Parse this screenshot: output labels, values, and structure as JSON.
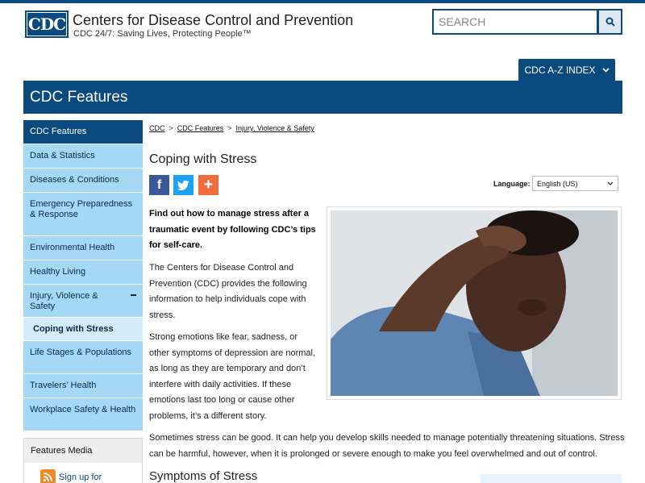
{
  "header": {
    "logo_text": "CDC",
    "agency_name": "Centers for Disease Control and Prevention",
    "tagline": "CDC 24/7: Saving Lives, Protecting People™",
    "search_placeholder": "SEARCH",
    "search_icon": "search-icon",
    "az_index_label": "CDC A-Z INDEX"
  },
  "banner": {
    "title": "CDC Features"
  },
  "sidebar": {
    "items": [
      {
        "label": "CDC Features",
        "active": true
      },
      {
        "label": "Data & Statistics"
      },
      {
        "label": "Diseases & Conditions"
      },
      {
        "label": "Emergency Preparedness & Response"
      },
      {
        "label": "Environmental Health"
      },
      {
        "label": "Healthy Living"
      },
      {
        "label": "Injury, Violence & Safety",
        "expanded": true
      },
      {
        "label": "Coping with Stress",
        "sub": true
      },
      {
        "label": "Life Stages & Populations"
      },
      {
        "label": "Travelers’ Health"
      },
      {
        "label": "Workplace Safety & Health"
      }
    ],
    "features_media": {
      "title": "Features Media",
      "signup_label": "Sign up for"
    }
  },
  "breadcrumb": {
    "items": [
      "CDC",
      "CDC Features",
      "Injury, Violence & Safety"
    ],
    "separator": ">"
  },
  "article": {
    "title": "Coping with Stress",
    "share": {
      "facebook": "f",
      "twitter": "twitter-icon",
      "plus": "+"
    },
    "language_label": "Language:",
    "language_value": "English (US)",
    "lead": "Find out how to manage stress after a traumatic event by following CDC’s tips for self-care.",
    "para1": "The Centers for Disease Control and Prevention (CDC) provides the following information to help individuals cope with stress.",
    "para2": "Strong emotions like fear, sadness, or other symptoms of depression are normal, as long as they are temporary and don’t interfere with daily activities. If these emotions last too long or cause other problems, it’s a different story.",
    "para3": "Sometimes stress can be good. It can help you develop skills needed to manage potentially threatening situations. Stress can be harmful, however, when it is prolonged or severe enough to make you feel overwhelmed and out of control.",
    "section_title": "Symptoms of Stress"
  },
  "colors": {
    "brand_blue": "#0b4a7e",
    "nav_bg": "#a4d8f4",
    "facebook": "#3b5998",
    "twitter": "#1da1f2",
    "plus": "#f26b3a"
  }
}
